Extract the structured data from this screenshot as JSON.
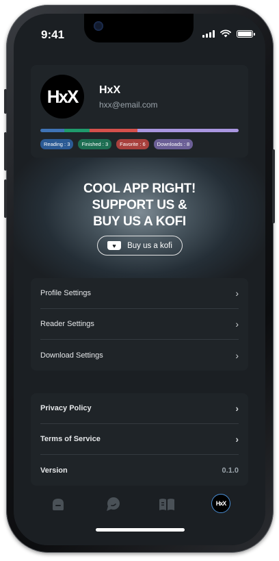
{
  "status_bar": {
    "time": "9:41"
  },
  "profile": {
    "avatar_text": "HxX",
    "name": "HxX",
    "email": "hxx@email.com",
    "progress_segments": [
      {
        "color": "#3f73b5",
        "fraction": 0.12
      },
      {
        "color": "#1f9a6c",
        "fraction": 0.13
      },
      {
        "color": "#d5504c",
        "fraction": 0.24
      },
      {
        "color": "#a996e0",
        "fraction": 0.51
      }
    ],
    "badges": [
      {
        "label": "Reading : 3",
        "color": "#2b5a94"
      },
      {
        "label": "Finished : 3",
        "color": "#1d6e52"
      },
      {
        "label": "Favorite : 6",
        "color": "#a8403d"
      },
      {
        "label": "Downloads : 8",
        "color": "#6b5f96"
      }
    ]
  },
  "promo": {
    "line1": "COOL APP RIGHT!",
    "line2": "SUPPORT US &",
    "line3": "BUY US A KOFI",
    "button_label": "Buy us a kofi"
  },
  "settings_menu": [
    {
      "label": "Profile Settings"
    },
    {
      "label": "Reader Settings"
    },
    {
      "label": "Download Settings"
    }
  ],
  "info_menu": [
    {
      "label": "Privacy Policy"
    },
    {
      "label": "Terms of Service"
    },
    {
      "label": "Version",
      "value": "0.1.0"
    }
  ],
  "tabbar": {
    "tabs": [
      {
        "icon": "home-icon"
      },
      {
        "icon": "chat-icon"
      },
      {
        "icon": "book-icon"
      },
      {
        "icon": "profile-avatar-icon",
        "text": "HxX"
      }
    ]
  },
  "colors": {
    "background": "#1b1f23",
    "card": "#1f2428",
    "accent_reading": "#3f73b5",
    "accent_finished": "#1f9a6c",
    "accent_favorite": "#d5504c",
    "accent_downloads": "#a996e0"
  }
}
